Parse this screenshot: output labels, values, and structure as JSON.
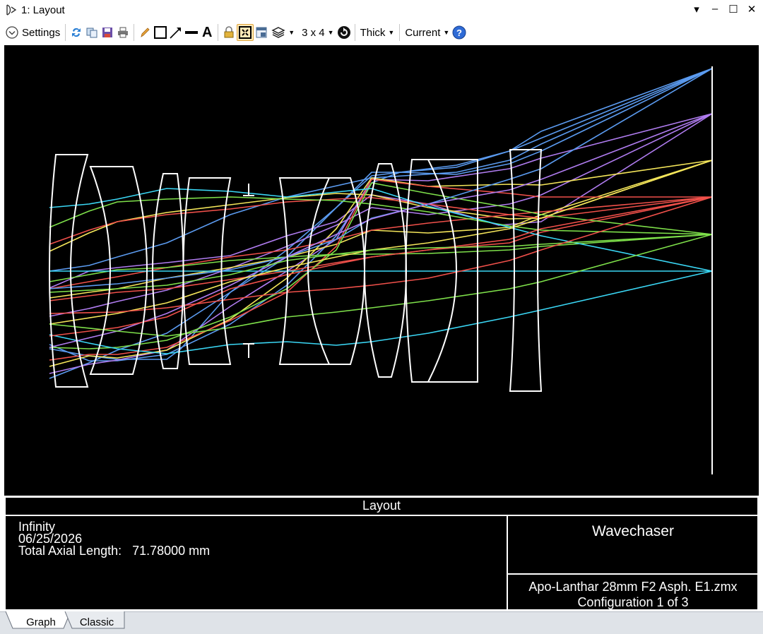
{
  "window": {
    "title": "1: Layout"
  },
  "toolbar": {
    "settings_label": "Settings",
    "grid_label": "3 x 4",
    "thickness_label": "Thick",
    "config_label": "Current",
    "icons": [
      "refresh-icon",
      "copy-icon",
      "save-icon",
      "print-icon",
      "pencil-icon",
      "rectangle-icon",
      "arrow-line-icon",
      "line-icon",
      "text-icon",
      "lock-icon",
      "normalize-icon",
      "window-icon",
      "layers-icon",
      "rotate-icon",
      "help-icon"
    ]
  },
  "info": {
    "panel_title": "Layout",
    "lines": [
      "Infinity",
      "06/25/2026",
      "Total Axial Length:   71.78000 mm"
    ],
    "company": "Wavechaser",
    "file": "Apo-Lanthar 28mm F2 Asph. E1.zmx",
    "configuration": "Configuration 1 of 3"
  },
  "tabs": [
    {
      "label": "Graph",
      "active": true
    },
    {
      "label": "Classic",
      "active": false
    }
  ],
  "colors": {
    "plot_background": "#000000",
    "lens_outline": "#ffffff",
    "field_colors": [
      "#5b9bf0",
      "#b07cf0",
      "#f5e65a",
      "#f0504a",
      "#7ee04a",
      "#3ad7f5"
    ]
  }
}
